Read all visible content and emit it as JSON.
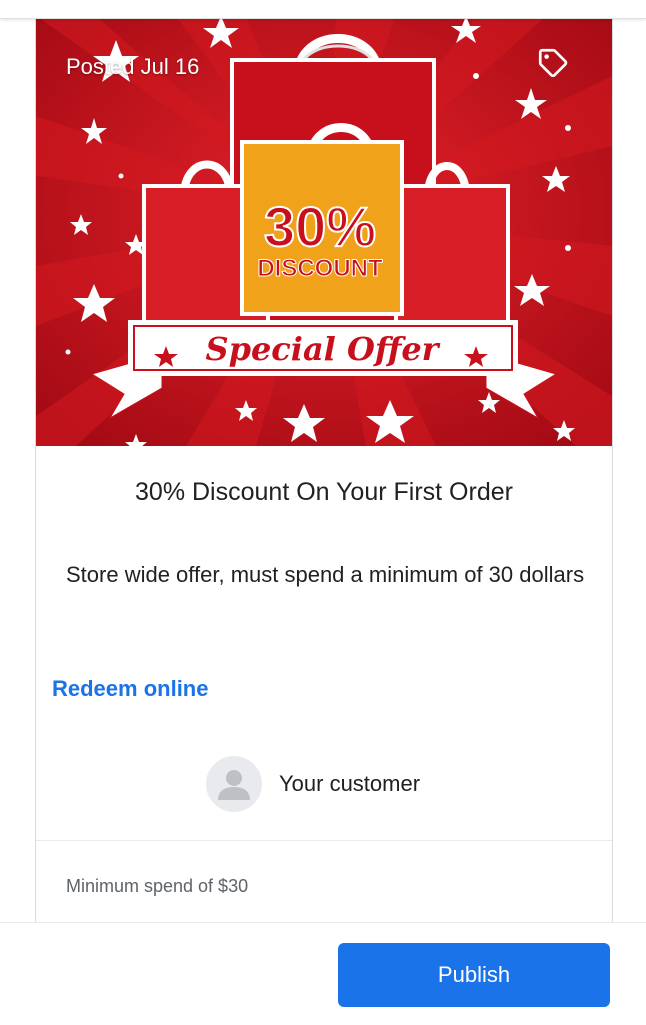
{
  "offer": {
    "posted_label": "Posted Jul 16",
    "image": {
      "percent_text": "30%",
      "discount_text": "DISCOUNT",
      "banner_text": "Special Offer"
    },
    "title": "30% Discount On Your First Order",
    "description": "Store wide offer, must spend a minimum of 30 dollars",
    "redeem_label": "Redeem online",
    "customer_label": "Your customer",
    "min_spend": "Minimum spend of $30"
  },
  "footer": {
    "publish_label": "Publish"
  },
  "colors": {
    "accent": "#1a73e8",
    "hero_red": "#c8101c",
    "bag_orange": "#f0a21b"
  },
  "icons": {
    "tag": "tag-icon",
    "avatar": "person-icon"
  }
}
